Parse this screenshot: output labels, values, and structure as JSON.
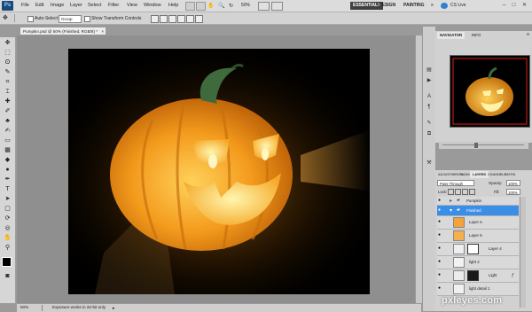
{
  "app": {
    "logo": "Ps"
  },
  "menu": {
    "items": [
      "File",
      "Edit",
      "Image",
      "Layer",
      "Select",
      "Filter",
      "View",
      "Window",
      "Help"
    ]
  },
  "appbar": {
    "zoom": "50%"
  },
  "workspace": {
    "essentials": "ESSENTIALS",
    "design": "DESIGN",
    "painting": "PAINTING",
    "more": "»",
    "cslive": "CS Live"
  },
  "options": {
    "auto_select": "Auto-Select:",
    "auto_select_value": "Group",
    "show_transform": "Show Transform Controls"
  },
  "document": {
    "tab": "Pumpkin.psd @ 50% (Finished, RGB/8) *",
    "close": "×"
  },
  "status": {
    "zoom": "50%",
    "message": "Exposure works in 32-bit only"
  },
  "navigator": {
    "tabs": [
      "NAVIGATOR",
      "INFO"
    ]
  },
  "layers_panel": {
    "tabs": [
      "ADJUSTMENTS",
      "MASKS",
      "LAYERS",
      "CHANNELS",
      "PATHS"
    ],
    "blend_mode": "Pass Through",
    "opacity_label": "Opacity:",
    "opacity_value": "100%",
    "lock_label": "Lock:",
    "fill_label": "Fill:",
    "fill_value": "100%",
    "layers": [
      {
        "name": "Pumpkin",
        "kind": "group"
      },
      {
        "name": "Finished",
        "kind": "group",
        "selected": true
      },
      {
        "name": "Layer 6",
        "kind": "layer"
      },
      {
        "name": "Layer 5",
        "kind": "layer"
      },
      {
        "name": "Layer 4",
        "kind": "mask"
      },
      {
        "name": "light 2",
        "kind": "layer"
      },
      {
        "name": "Light",
        "kind": "mask"
      },
      {
        "name": "light detail 1",
        "kind": "layer"
      }
    ]
  },
  "watermark": {
    "text": "pxleyes.com"
  },
  "colors": {
    "selection": "#3b8ee6",
    "canvas_bg": "#000000",
    "pumpkin_orange": "#f39a1c",
    "stem_green": "#3f6a3c"
  }
}
